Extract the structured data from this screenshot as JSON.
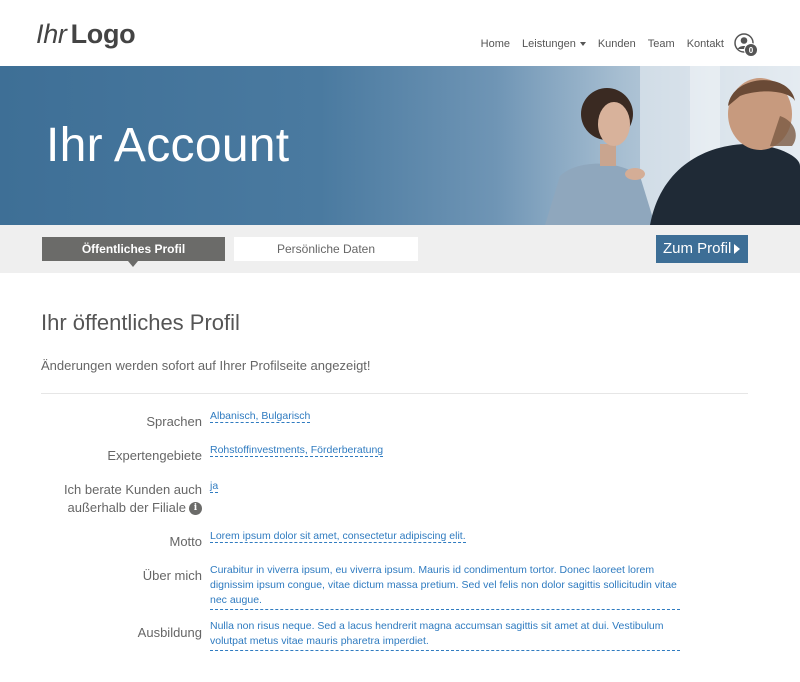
{
  "header": {
    "logo_part1": "Ihr",
    "logo_part2": "Logo",
    "nav": [
      {
        "label": "Home"
      },
      {
        "label": "Leistungen"
      },
      {
        "label": "Kunden"
      },
      {
        "label": "Team"
      },
      {
        "label": "Kontakt"
      }
    ],
    "user_icon": "user-circle-icon",
    "cart_count": "0"
  },
  "hero": {
    "title": "Ihr Account"
  },
  "tabs": {
    "active": "Öffentliches Profil",
    "inactive": "Persönliche Daten",
    "profile_button": "Zum Profil"
  },
  "main": {
    "title": "Ihr öffentliches Profil",
    "notice": "Änderungen werden sofort auf Ihrer Profilseite angezeigt!"
  },
  "fields": {
    "languages_label": "Sprachen",
    "languages_value": "Albanisch, Bulgarisch",
    "expertise_label": "Expertengebiete",
    "expertise_value": "Rohstoffinvestments, Förderberatung",
    "outside_label_line1": "Ich berate Kunden auch",
    "outside_label_line2": "außerhalb der Filiale",
    "outside_value": "ja",
    "motto_label": "Motto",
    "motto_value": "Lorem ipsum dolor sit amet, consectetur adipiscing elit.",
    "about_label": "Über mich",
    "about_value": "Curabitur in viverra ipsum, eu viverra ipsum. Mauris id condimentum tortor. Donec laoreet lorem dignissim ipsum congue, vitae dictum massa pretium. Sed vel felis non dolor sagittis sollicitudin vitae nec augue.",
    "education_label": "Ausbildung",
    "education_value": "Nulla non risus neque. Sed a lacus hendrerit magna accumsan sagittis sit amet at dui. Vestibulum volutpat metus vitae mauris pharetra imperdiet."
  },
  "colors": {
    "accent": "#3d6e96",
    "link": "#2f7bc0",
    "tab_active": "#6b6b69"
  }
}
